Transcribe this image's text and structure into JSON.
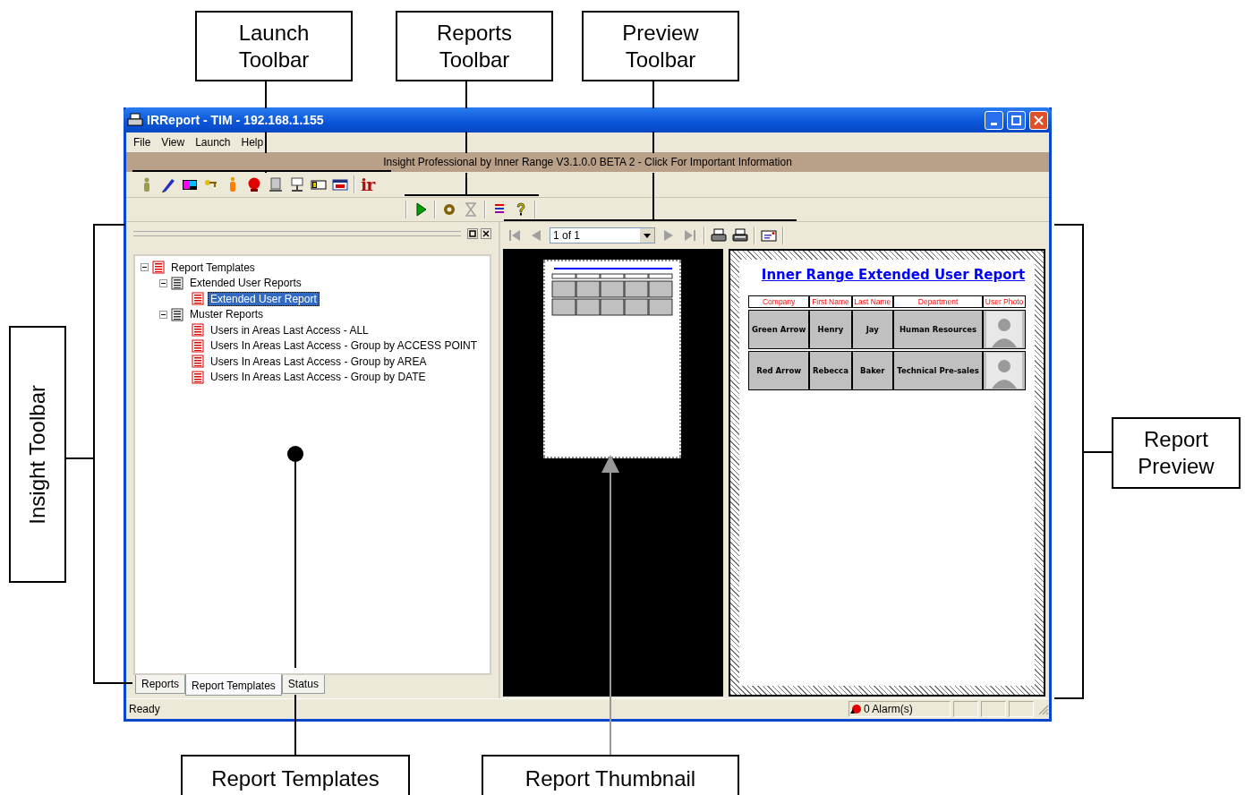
{
  "callouts": [
    {
      "label": "Launch Toolbar",
      "kind": "box"
    },
    {
      "label": "Reports Toolbar",
      "kind": "box"
    },
    {
      "label": "Preview Toolbar",
      "kind": "box"
    },
    {
      "label": "Insight Toolbar",
      "kind": "vertical"
    },
    {
      "label": "Report Preview",
      "kind": "box"
    },
    {
      "label": "Report Templates",
      "kind": "box"
    },
    {
      "label": "Report Thumbnail",
      "kind": "box"
    }
  ],
  "window": {
    "title": "IRReport - TIM - 192.168.1.155",
    "menu": [
      "File",
      "View",
      "Launch",
      "Help"
    ],
    "info_bar": "Insight Professional by Inner Range V3.1.0.0 BETA 2 - Click For Important Information",
    "launch_toolbar": {
      "icons": [
        {
          "kind": "person"
        },
        {
          "kind": "pen"
        },
        {
          "kind": "blocks"
        },
        {
          "kind": "key"
        },
        {
          "kind": "figure"
        },
        {
          "kind": "bell"
        },
        {
          "kind": "cylinder"
        },
        {
          "kind": "monitor"
        },
        {
          "kind": "card"
        },
        {
          "kind": "calendar"
        }
      ],
      "logo": "ir"
    },
    "reports_toolbar": [
      {
        "kind": "play",
        "disabled": false
      },
      {
        "kind": "gear",
        "disabled": false
      },
      {
        "kind": "hourglass",
        "disabled": true
      },
      {
        "kind": "list",
        "disabled": false
      },
      {
        "kind": "help",
        "disabled": false
      }
    ],
    "tree": [
      {
        "label": "Report Templates",
        "kind": "report",
        "selected": false,
        "expanded": true,
        "children": [
          {
            "label": "Extended User Reports",
            "kind": "folder",
            "selected": false,
            "expanded": true,
            "children": [
              {
                "label": "Extended User Report",
                "kind": "report",
                "selected": true
              }
            ]
          },
          {
            "label": "Muster Reports",
            "kind": "folder",
            "selected": false,
            "expanded": true,
            "children": [
              {
                "label": "Users in Areas Last Access - ALL",
                "kind": "report",
                "selected": false
              },
              {
                "label": "Users In Areas Last Access - Group by ACCESS POINT",
                "kind": "report",
                "selected": false
              },
              {
                "label": "Users In Areas Last Access - Group by AREA",
                "kind": "report",
                "selected": false
              },
              {
                "label": "Users In Areas Last Access - Group by DATE",
                "kind": "report",
                "selected": false
              }
            ]
          }
        ]
      }
    ],
    "tabs": [
      {
        "label": "Reports",
        "selected": false
      },
      {
        "label": "Report Templates",
        "selected": true
      },
      {
        "label": "Status",
        "selected": false
      }
    ],
    "preview_toolbar": {
      "nav": [
        {
          "kind": "first",
          "disabled": true
        },
        {
          "kind": "prev",
          "disabled": true
        }
      ],
      "page": "1 of 1",
      "nav_after": [
        {
          "kind": "next",
          "disabled": true
        },
        {
          "kind": "last",
          "disabled": true
        }
      ],
      "actions": [
        {
          "kind": "print"
        },
        {
          "kind": "print2"
        },
        {
          "kind": "email"
        }
      ]
    },
    "report": {
      "title": "Inner Range Extended User Report",
      "columns": [
        "Company",
        "First Name",
        "Last Name",
        "Department",
        "User Photo"
      ],
      "rows": [
        {
          "cells": [
            "Green Arrow",
            "Henry",
            "Jay",
            "Human Resources"
          ]
        },
        {
          "cells": [
            "Red Arrow",
            "Rebecca",
            "Baker",
            "Technical Pre-sales"
          ]
        }
      ]
    },
    "status": {
      "text": "Ready",
      "alarm": "0 Alarm(s)"
    }
  }
}
